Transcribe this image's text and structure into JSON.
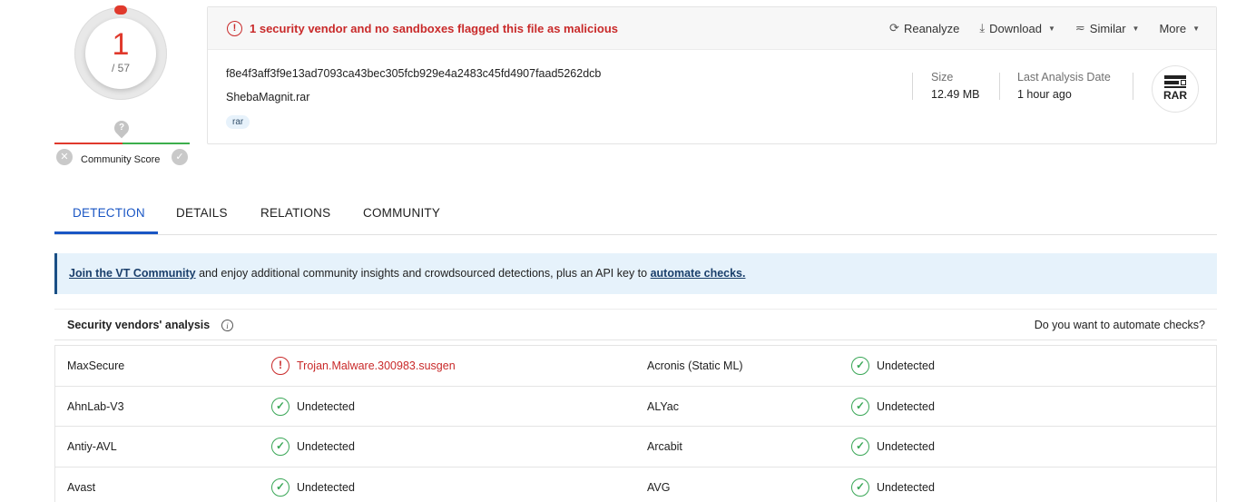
{
  "score": {
    "detections": "1",
    "total": "/ 57",
    "community_label": "Community Score"
  },
  "alert": {
    "text": "1 security vendor and no sandboxes flagged this file as malicious"
  },
  "actions": {
    "reanalyze": "Reanalyze",
    "download": "Download",
    "similar": "Similar",
    "more": "More"
  },
  "file": {
    "hash": "f8e4f3aff3f9e13ad7093ca43bec305fcb929e4a2483c45fd4907faad5262dcb",
    "name": "ShebaMagnit.rar",
    "tag": "rar",
    "size_label": "Size",
    "size_value": "12.49 MB",
    "date_label": "Last Analysis Date",
    "date_value": "1 hour ago",
    "type_badge": "RAR"
  },
  "tabs": [
    "DETECTION",
    "DETAILS",
    "RELATIONS",
    "COMMUNITY"
  ],
  "banner": {
    "link1": "Join the VT Community",
    "middle": " and enjoy additional community insights and crowdsourced detections, plus an API key to ",
    "link2": "automate checks."
  },
  "analysis": {
    "title": "Security vendors' analysis",
    "automate_question": "Do you want to automate checks?",
    "rows": [
      {
        "v1": "MaxSecure",
        "r1": "Trojan.Malware.300983.susgen",
        "r1_malicious": true,
        "v2": "Acronis (Static ML)",
        "r2": "Undetected"
      },
      {
        "v1": "AhnLab-V3",
        "r1": "Undetected",
        "r1_malicious": false,
        "v2": "ALYac",
        "r2": "Undetected"
      },
      {
        "v1": "Antiy-AVL",
        "r1": "Undetected",
        "r1_malicious": false,
        "v2": "Arcabit",
        "r2": "Undetected"
      },
      {
        "v1": "Avast",
        "r1": "Undetected",
        "r1_malicious": false,
        "v2": "AVG",
        "r2": "Undetected"
      }
    ]
  },
  "colors": {
    "malicious": "#c92a2a",
    "clean": "#3aa757",
    "accent": "#1a56c4"
  }
}
